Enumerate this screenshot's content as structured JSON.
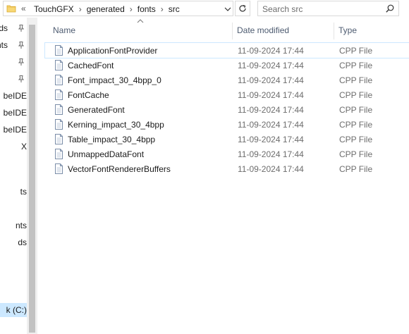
{
  "address_bar": {
    "overflow_label": "«",
    "breadcrumbs": [
      "TouchGFX",
      "generated",
      "fonts",
      "src"
    ],
    "separator": "›"
  },
  "search": {
    "placeholder": "Search src"
  },
  "navigation_pane": {
    "items": [
      {
        "label": "ds",
        "pinned": true
      },
      {
        "label": "nts",
        "pinned": true
      },
      {
        "label": "",
        "pinned": true
      },
      {
        "label": "",
        "pinned": true
      },
      {
        "label": "beIDE",
        "pinned": false
      },
      {
        "label": "beIDE",
        "pinned": false
      },
      {
        "label": "beIDE",
        "pinned": false
      },
      {
        "label": "X",
        "pinned": false
      },
      {
        "label": "ts",
        "pinned": false
      },
      {
        "label": "nts",
        "pinned": false
      },
      {
        "label": "ds",
        "pinned": false
      },
      {
        "label": "k (C:)",
        "pinned": false,
        "selected": true
      }
    ]
  },
  "columns": {
    "name": "Name",
    "date_modified": "Date modified",
    "type": "Type"
  },
  "files": [
    {
      "name": "ApplicationFontProvider",
      "date": "11-09-2024 17:44",
      "type": "CPP File",
      "hover": true
    },
    {
      "name": "CachedFont",
      "date": "11-09-2024 17:44",
      "type": "CPP File"
    },
    {
      "name": "Font_impact_30_4bpp_0",
      "date": "11-09-2024 17:44",
      "type": "CPP File"
    },
    {
      "name": "FontCache",
      "date": "11-09-2024 17:44",
      "type": "CPP File"
    },
    {
      "name": "GeneratedFont",
      "date": "11-09-2024 17:44",
      "type": "CPP File"
    },
    {
      "name": "Kerning_impact_30_4bpp",
      "date": "11-09-2024 17:44",
      "type": "CPP File"
    },
    {
      "name": "Table_impact_30_4bpp",
      "date": "11-09-2024 17:44",
      "type": "CPP File"
    },
    {
      "name": "UnmappedDataFont",
      "date": "11-09-2024 17:44",
      "type": "CPP File"
    },
    {
      "name": "VectorFontRendererBuffers",
      "date": "11-09-2024 17:44",
      "type": "CPP File"
    }
  ],
  "icons": {
    "folder": "folder-icon",
    "dropdown": "chevron-down-icon",
    "refresh": "refresh-icon",
    "search": "search-icon",
    "pin": "pin-icon",
    "file": "cpp-file-icon",
    "sort": "sort-up-icon"
  },
  "colors": {
    "header_text": "#4d5b70",
    "folder_yellow": "#f8d775",
    "selection_blue": "#cce8ff"
  }
}
